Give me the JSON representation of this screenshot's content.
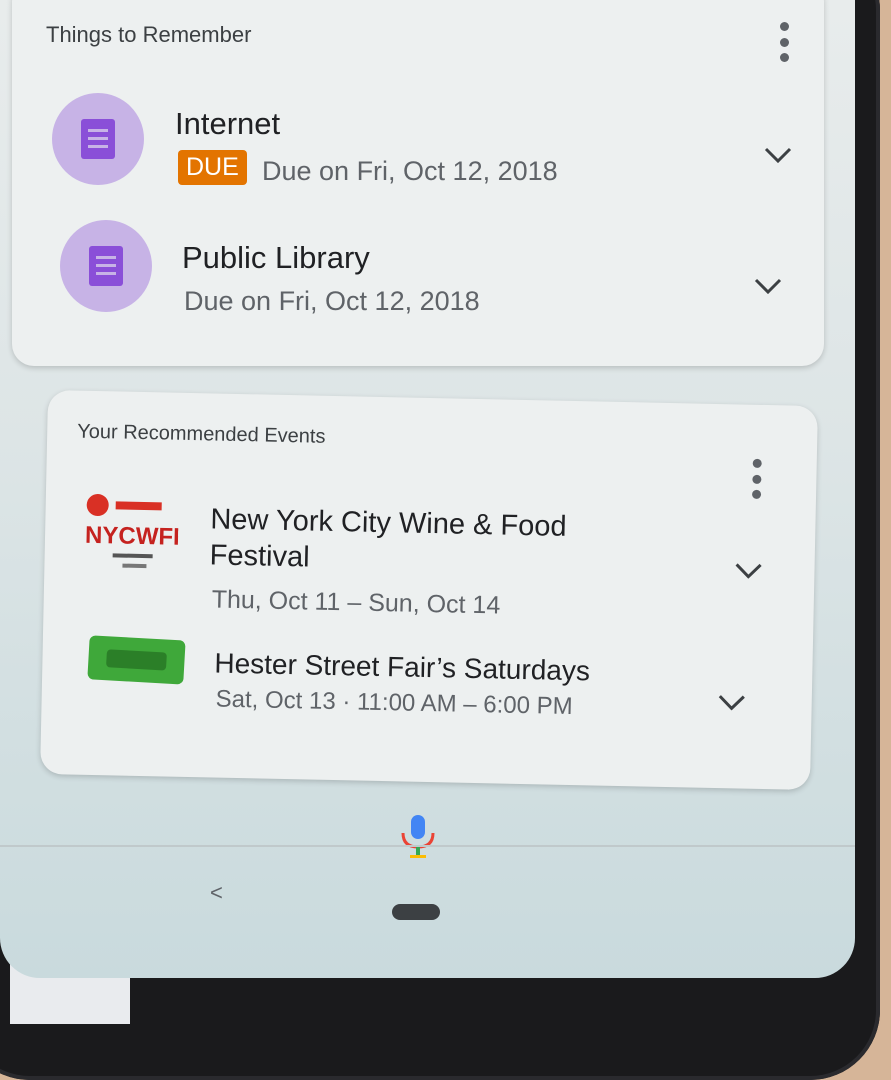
{
  "things": {
    "title": "Things to Remember",
    "items": [
      {
        "title": "Internet",
        "badge": "DUE",
        "subtitle": "Due on Fri, Oct 12, 2018"
      },
      {
        "title": "Public Library",
        "subtitle": "Due on Fri, Oct 12, 2018"
      }
    ]
  },
  "events": {
    "title": "Your Recommended Events",
    "items": [
      {
        "title_line1": "New York City Wine & Food",
        "title_line2": "Festival",
        "subtitle": "Thu, Oct 11 – Sun, Oct 14",
        "logo_text": "NYCWFF"
      },
      {
        "title": "Hester Street Fair’s Saturdays",
        "subtitle": "Sat, Oct 13 · 11:00 AM – 6:00 PM"
      }
    ]
  },
  "nav": {
    "back": "<"
  },
  "colors": {
    "accent_purple": "#8a4fd8",
    "avatar_bg": "#c7b3e6",
    "due_orange": "#e37400",
    "hester_green": "#3fa83a"
  },
  "icons": [
    "more-vert-icon",
    "document-icon",
    "chevron-down-icon",
    "microphone-icon",
    "back-icon",
    "home-pill-icon"
  ]
}
